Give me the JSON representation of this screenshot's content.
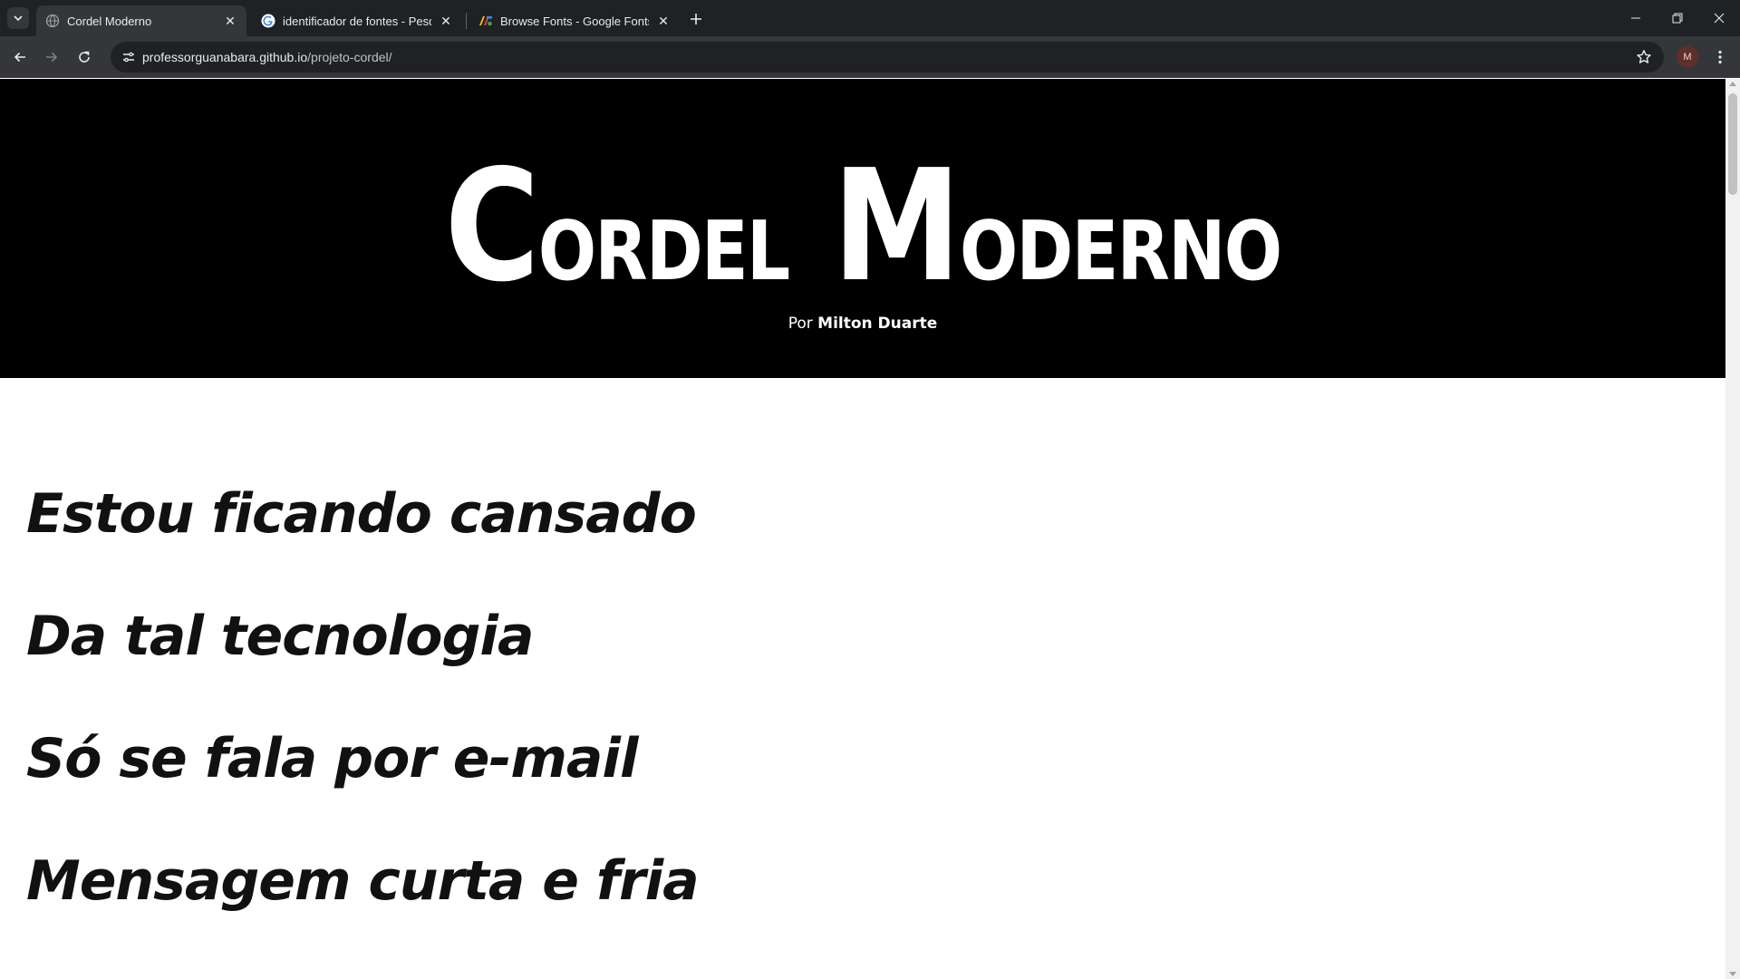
{
  "browser": {
    "tabs": [
      {
        "title": "Cordel Moderno",
        "active": true,
        "favicon": "globe-icon"
      },
      {
        "title": "identificador de fontes - Pesqui",
        "active": false,
        "favicon": "google-icon"
      },
      {
        "title": "Browse Fonts - Google Fonts",
        "active": false,
        "favicon": "google-fonts-icon"
      }
    ],
    "url_host": "professorguanabara.github.io",
    "url_path": "/projeto-cordel/",
    "profile_initial": "M"
  },
  "page": {
    "title_big_1": "C",
    "title_small_1": "ordel",
    "title_big_2": "M",
    "title_small_2": "oderno",
    "byline_prefix": "Por",
    "author": "Milton Duarte",
    "verses": [
      "Estou ficando cansado",
      "Da tal tecnologia",
      "Só se fala por e-mail",
      "Mensagem curta e fria"
    ]
  },
  "colors": {
    "hero_bg": "#000000",
    "chrome_dark": "#202124",
    "chrome_toolbar": "#35363a"
  }
}
